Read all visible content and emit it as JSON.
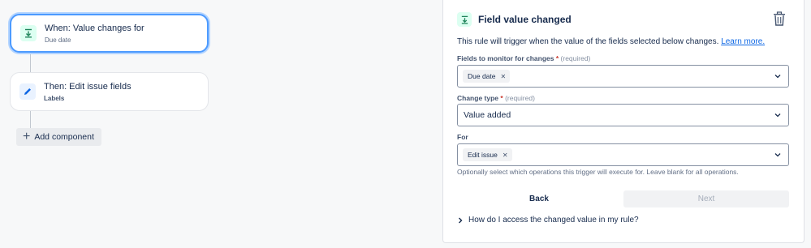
{
  "flow": {
    "trigger": {
      "title": "When: Value changes for",
      "subtitle": "Due date",
      "icon": "download-arrow-icon"
    },
    "action": {
      "title": "Then: Edit issue fields",
      "subtitle": "Labels",
      "icon": "pencil-icon"
    },
    "add_component_label": "Add component"
  },
  "panel": {
    "title": "Field value changed",
    "description": "This rule will trigger when the value of the fields selected below changes.",
    "learn_more": "Learn more.",
    "fields_label": "Fields to monitor for changes",
    "fields_required_hint": "(required)",
    "fields_tags": [
      "Due date"
    ],
    "change_type_label": "Change type",
    "change_type_required_hint": "(required)",
    "change_type_value": "Value added",
    "for_label": "For",
    "for_tags": [
      "Edit issue"
    ],
    "for_helper": "Optionally select which operations this trigger will execute for. Leave blank for all operations.",
    "back_label": "Back",
    "next_label": "Next",
    "expander_label": "How do I access the changed value in my rule?"
  },
  "colors": {
    "accent": "#0c66e4",
    "trigger_green": "#1f845a",
    "selected_border": "#4c9aff",
    "required": "#c9372c"
  }
}
